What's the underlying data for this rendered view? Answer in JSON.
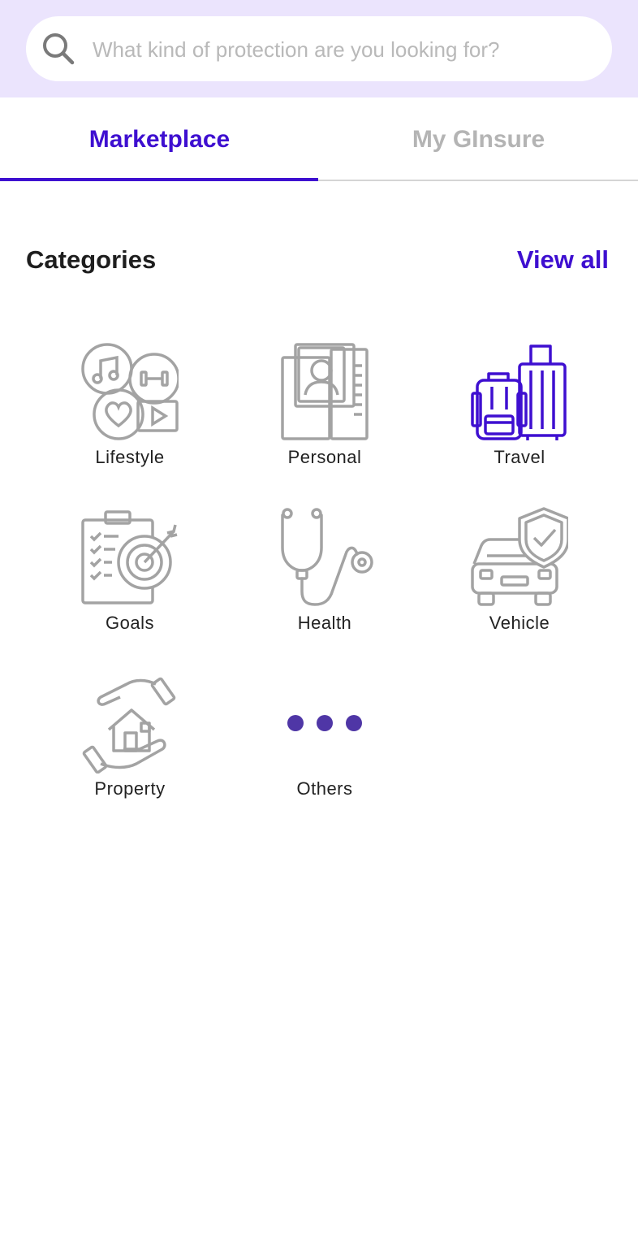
{
  "search": {
    "placeholder": "What kind of protection are you looking for?",
    "icon": "search-icon"
  },
  "tabs": [
    {
      "label": "Marketplace",
      "active": true
    },
    {
      "label": "My GInsure",
      "active": false
    }
  ],
  "categories_section": {
    "title": "Categories",
    "view_all": "View all"
  },
  "categories": [
    {
      "label": "Lifestyle",
      "icon": "lifestyle-icon"
    },
    {
      "label": "Personal",
      "icon": "personal-id-icon"
    },
    {
      "label": "Travel",
      "icon": "luggage-icon",
      "highlighted": true
    },
    {
      "label": "Goals",
      "icon": "goals-target-icon"
    },
    {
      "label": "Health",
      "icon": "stethoscope-icon"
    },
    {
      "label": "Vehicle",
      "icon": "car-shield-icon"
    },
    {
      "label": "Property",
      "icon": "house-in-hands-icon"
    },
    {
      "label": "Others",
      "icon": "more-dots-icon"
    }
  ],
  "colors": {
    "accent": "#3e0fd0",
    "header_bg": "#ebe4fd",
    "icon_gray": "#a3a3a3",
    "dots": "#4f36a6"
  }
}
